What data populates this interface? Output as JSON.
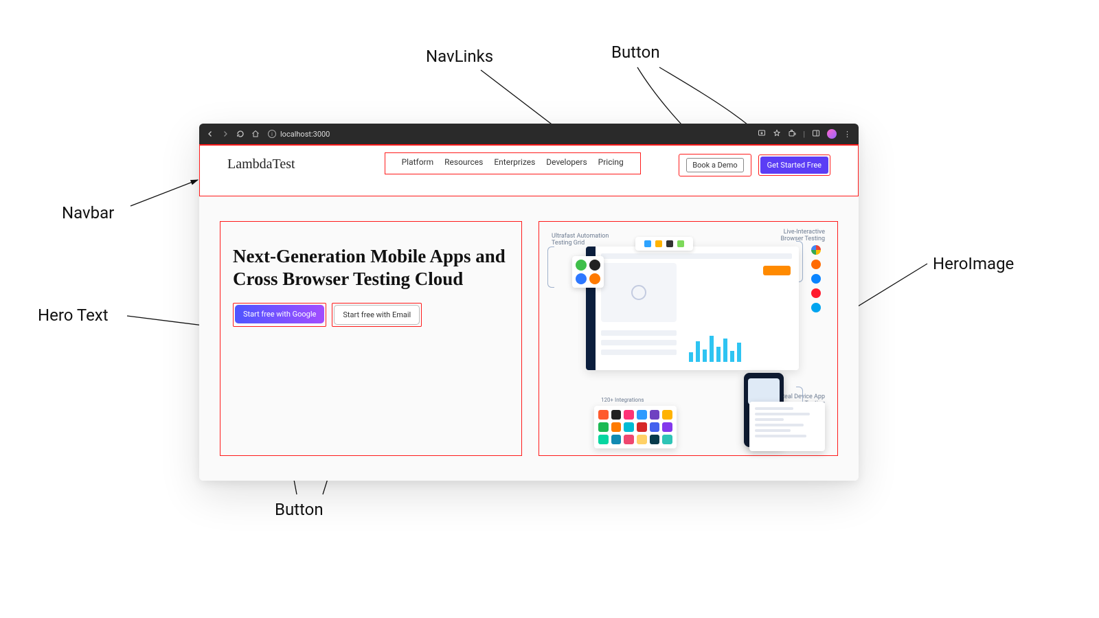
{
  "annotations": {
    "navlinks": "NavLinks",
    "button_top": "Button",
    "navbar": "Navbar",
    "hero_text": "Hero Text",
    "hero_image": "HeroImage",
    "button_bottom": "Button"
  },
  "chrome": {
    "url": "localhost:3000"
  },
  "navbar": {
    "brand": "LambdaTest",
    "links": [
      "Platform",
      "Resources",
      "Enterprizes",
      "Developers",
      "Pricing"
    ],
    "book_demo": "Book a Demo",
    "get_started": "Get Started Free"
  },
  "hero": {
    "title": "Next-Generation Mobile Apps and Cross Browser Testing Cloud",
    "cta_google": "Start free with Google",
    "cta_email": "Start free with Email"
  },
  "hero_image_labels": {
    "top_left": "Ultrafast Automation Testing Grid",
    "top_right": "Live-Interactive Browser Testing",
    "bottom_right": "Real Device App Testing",
    "integrations": "120+ Integrations"
  }
}
